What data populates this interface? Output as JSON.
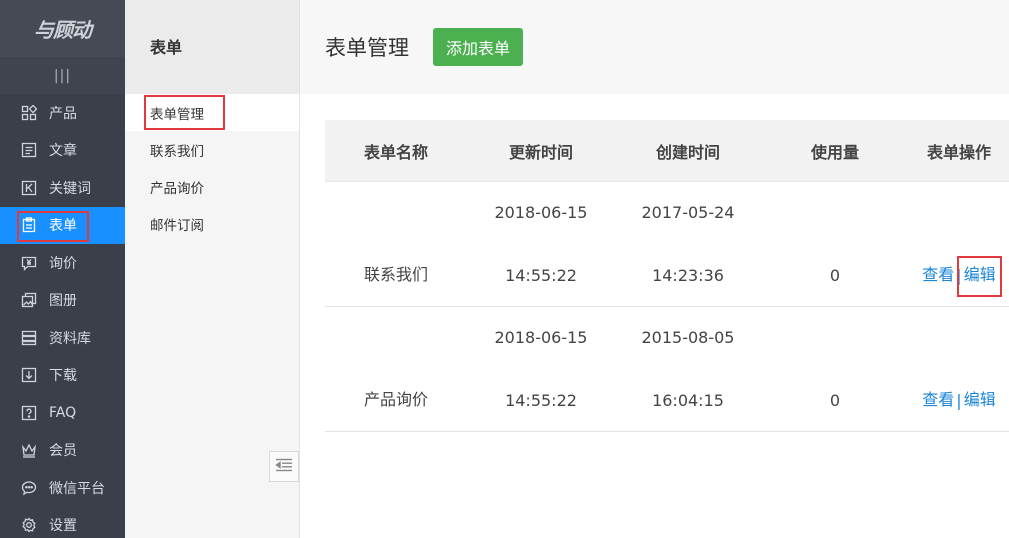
{
  "logo": "与顾动",
  "nav": {
    "toggle_glyph": "|||",
    "items": [
      {
        "label": "产品",
        "icon": "grid-icon"
      },
      {
        "label": "文章",
        "icon": "article-icon"
      },
      {
        "label": "关键词",
        "icon": "keyword-icon"
      },
      {
        "label": "表单",
        "icon": "form-icon"
      },
      {
        "label": "询价",
        "icon": "inquiry-icon"
      },
      {
        "label": "图册",
        "icon": "gallery-icon"
      },
      {
        "label": "资料库",
        "icon": "database-icon"
      },
      {
        "label": "下载",
        "icon": "download-icon"
      },
      {
        "label": "FAQ",
        "icon": "faq-icon"
      },
      {
        "label": "会员",
        "icon": "crown-icon"
      },
      {
        "label": "微信平台",
        "icon": "chat-icon"
      },
      {
        "label": "设置",
        "icon": "gear-icon"
      }
    ],
    "active_color": "#1890ff"
  },
  "subnav": {
    "title": "表单",
    "items": [
      "表单管理",
      "联系我们",
      "产品询价",
      "邮件订阅"
    ]
  },
  "header": {
    "title": "表单管理",
    "add_button": "添加表单",
    "add_button_color": "#4caf50"
  },
  "table": {
    "columns": [
      "表单名称",
      "更新时间",
      "创建时间",
      "使用量",
      "表单操作"
    ],
    "rows": [
      {
        "name": "联系我们",
        "updated_date": "2018-06-15",
        "updated_time": "14:55:22",
        "created_date": "2017-05-24",
        "created_time": "14:23:36",
        "usage": "0",
        "view": "查看",
        "sep": "|",
        "edit": "编辑"
      },
      {
        "name": "产品询价",
        "updated_date": "2018-06-15",
        "updated_time": "14:55:22",
        "created_date": "2015-08-05",
        "created_time": "16:04:15",
        "usage": "0",
        "view": "查看",
        "sep": "|",
        "edit": "编辑"
      }
    ]
  },
  "highlight_color": "#e0393e"
}
